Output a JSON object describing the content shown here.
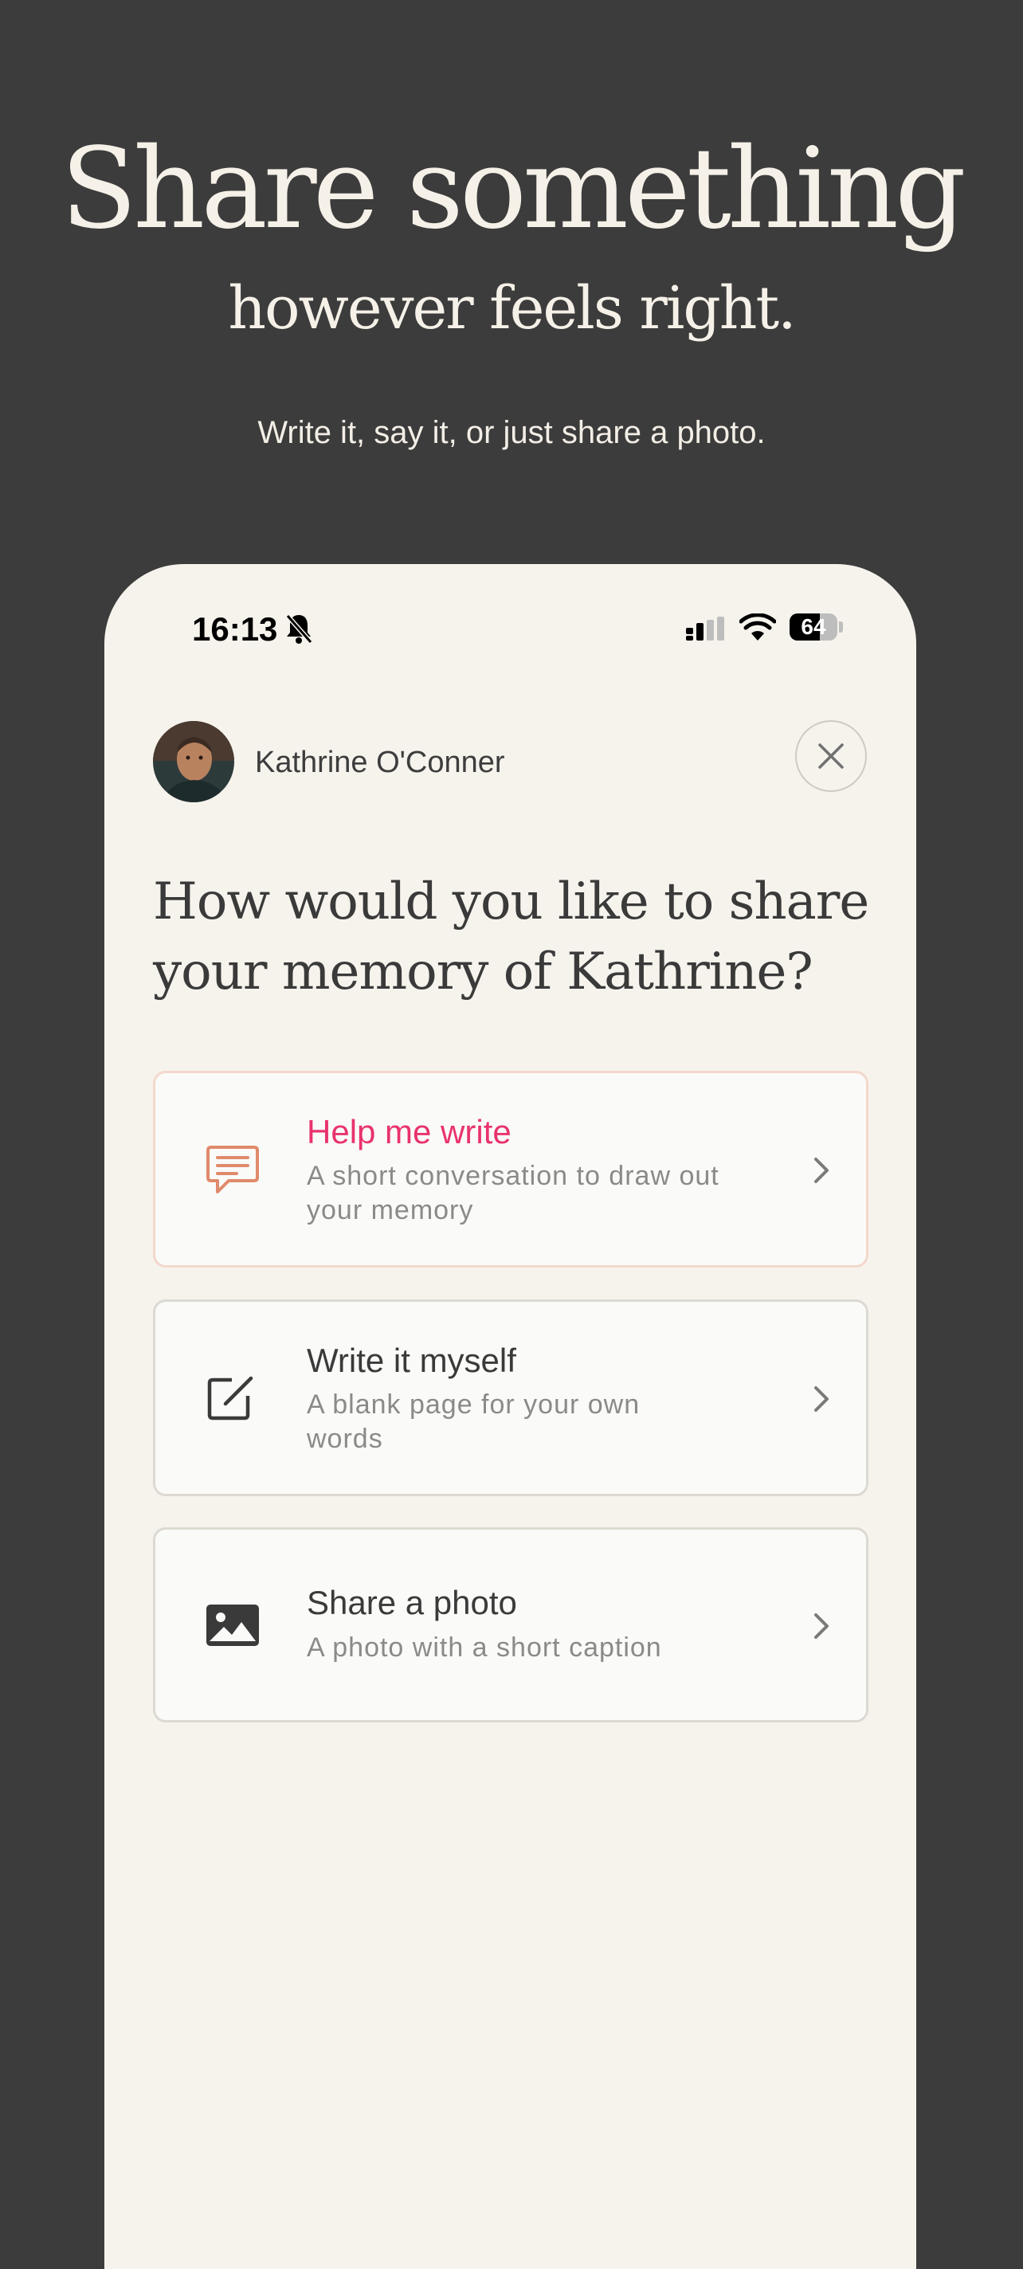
{
  "hero": {
    "title": "Share something",
    "subtitle": "however feels right.",
    "caption": "Write it, say it, or just share a photo."
  },
  "status_bar": {
    "time": "16:13",
    "battery_text": "64",
    "battery_level_percent": 64
  },
  "profile": {
    "name": "Kathrine O'Conner"
  },
  "question": "How would you like to share your memory of Kathrine?",
  "options": [
    {
      "title": "Help me write",
      "description": "A short conversation to draw out your memory",
      "icon": "chat-icon"
    },
    {
      "title": "Write it myself",
      "description": "A blank page for your own words",
      "icon": "edit-icon"
    },
    {
      "title": "Share a photo",
      "description": "A photo with a short caption",
      "icon": "image-icon"
    }
  ],
  "colors": {
    "page_background": "#3c3c3c",
    "card_background": "#f6f3ec",
    "accent_pink": "#e8336d",
    "accent_orange": "#e08a6b"
  }
}
